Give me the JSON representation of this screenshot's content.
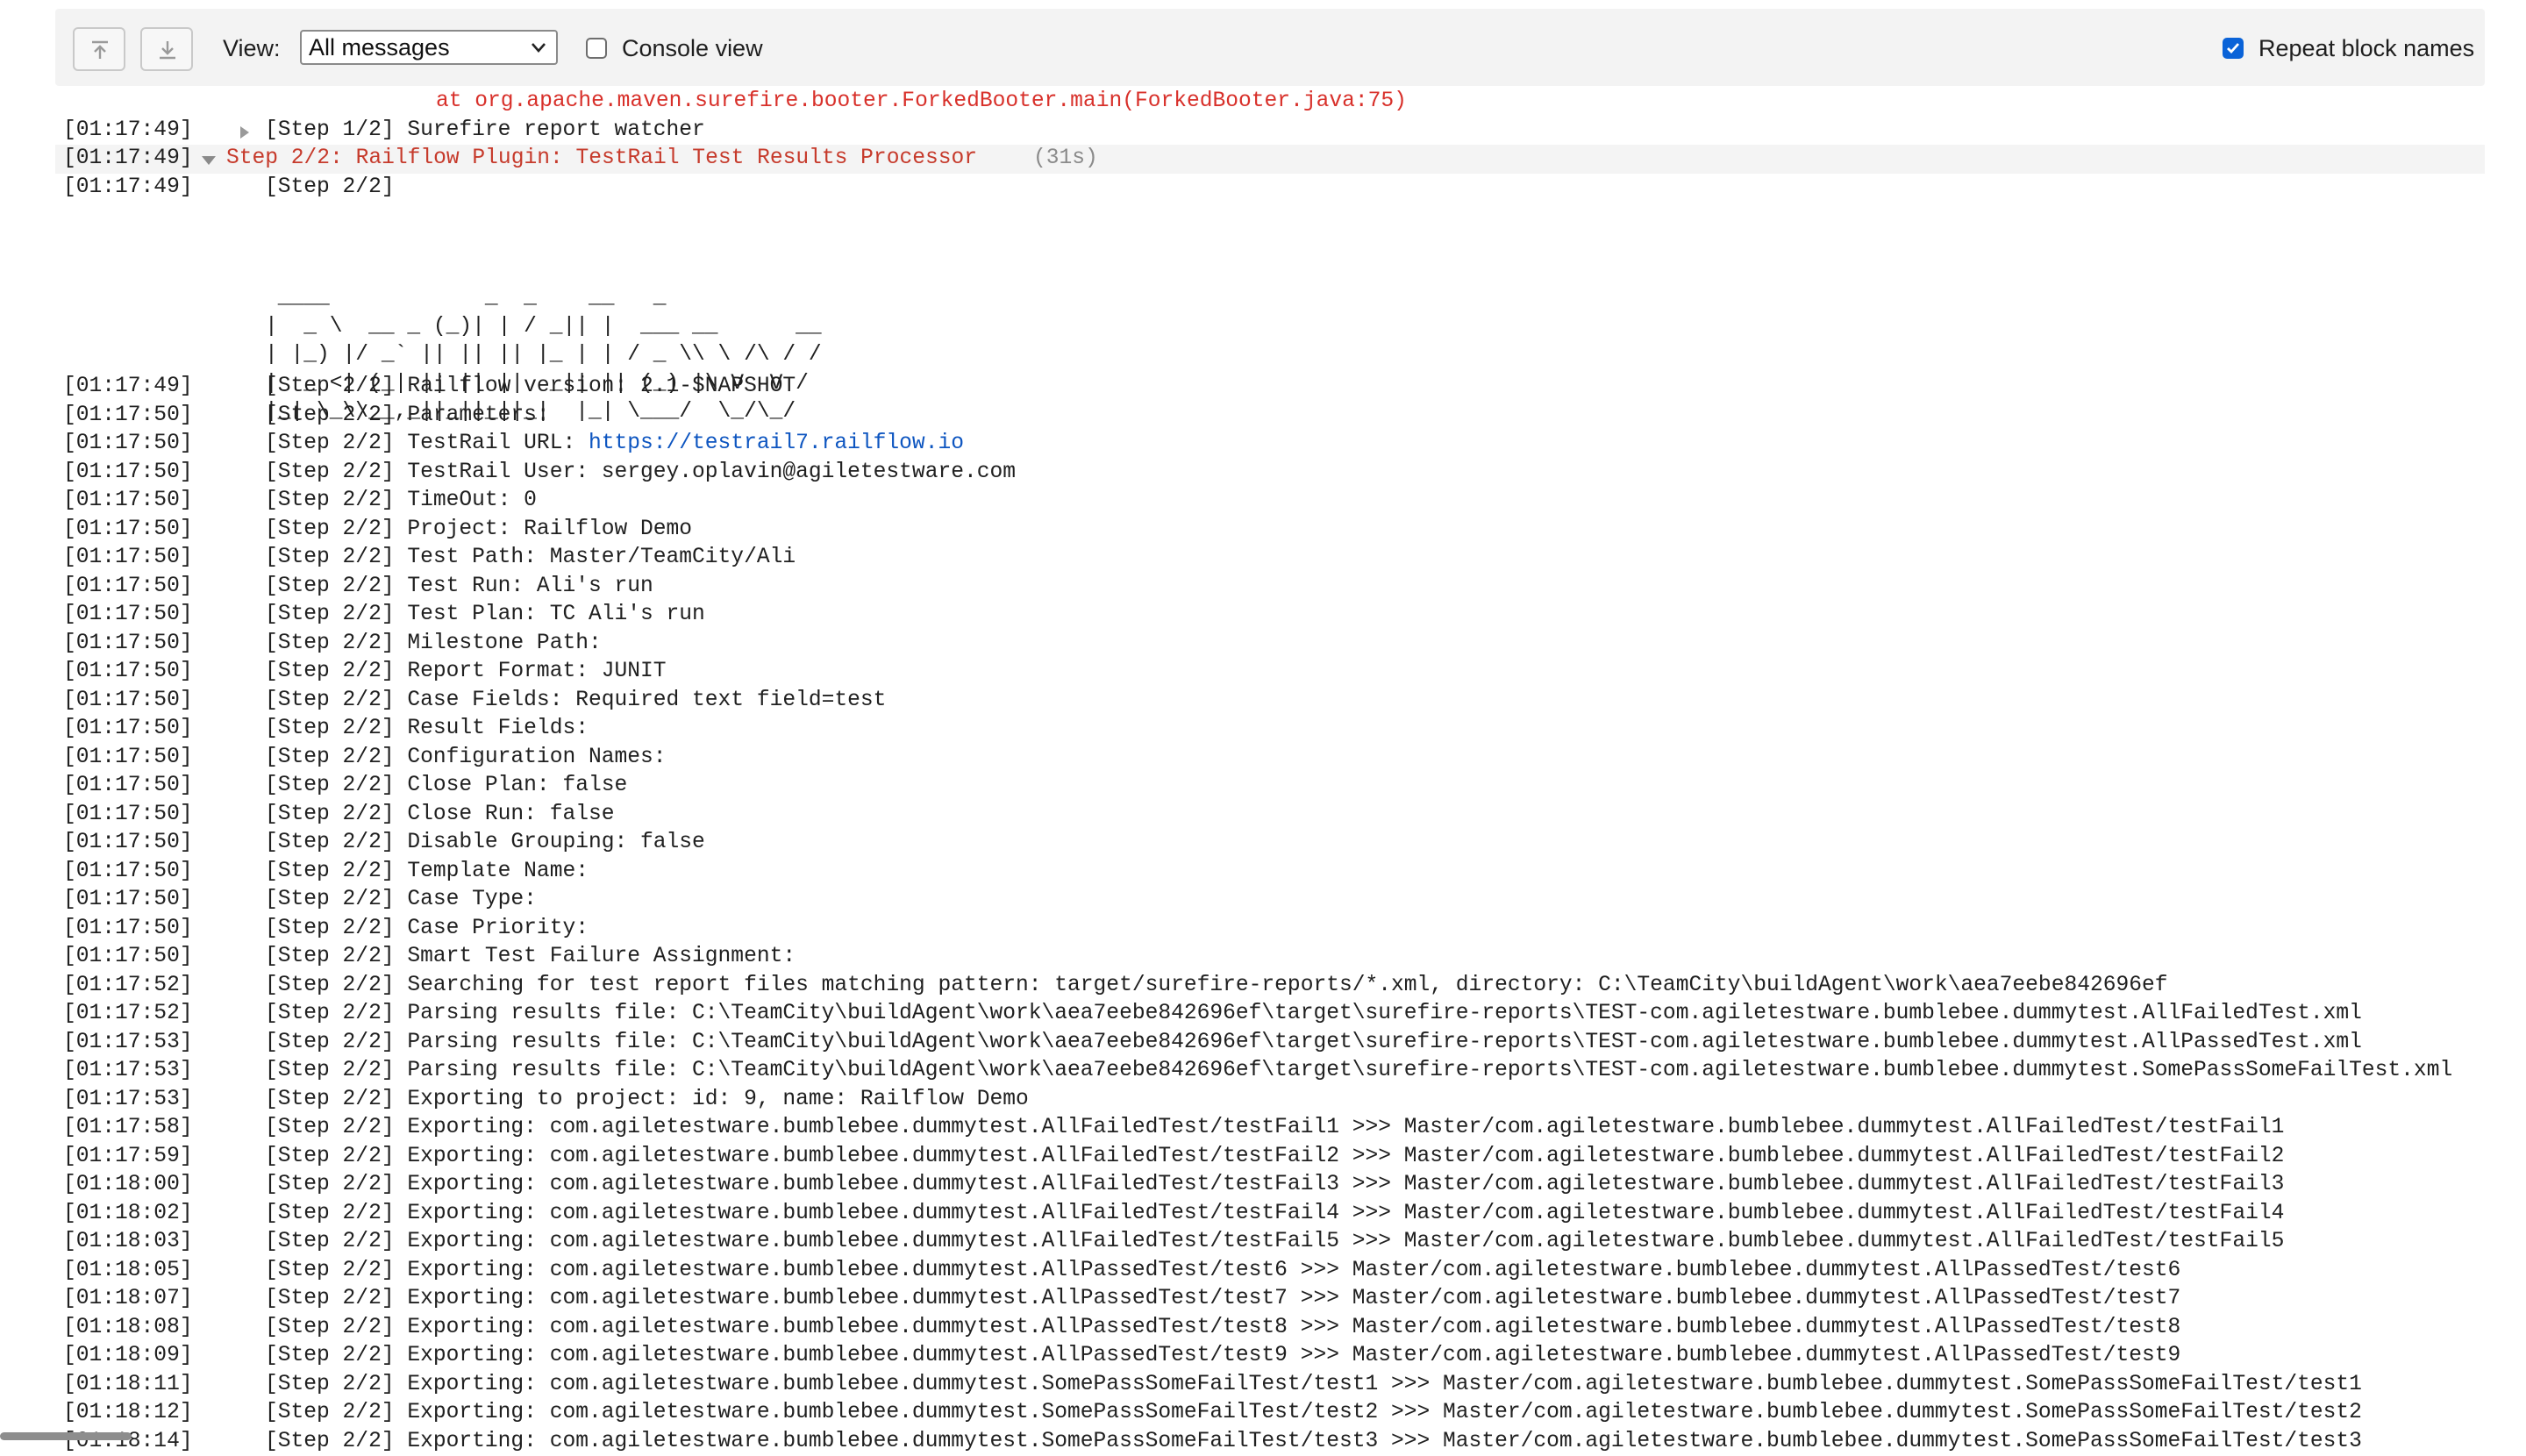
{
  "toolbar": {
    "view_label": "View:",
    "view_select_value": "All messages",
    "console_view_label": "Console view",
    "console_view_checked": false,
    "repeat_block_names_label": "Repeat block names",
    "repeat_block_names_checked": true,
    "icons": [
      "scroll-to-top-icon",
      "scroll-to-bottom-icon",
      "chevron-down-icon",
      "checkmark-icon"
    ],
    "accent_color": "#0a63d8"
  },
  "log": {
    "error_line": "at org.apache.maven.surefire.booter.ForkedBooter.main(ForkedBooter.java:75)",
    "step1": {
      "time": "[01:17:49]",
      "text": "[Step 1/2] Surefire report watcher"
    },
    "step2": {
      "time": "[01:17:49]",
      "title": "Step 2/2: Railflow Plugin: TestRail Test Results Processor",
      "duration": "(31s)"
    },
    "step2_header": {
      "time": "[01:17:49]",
      "text": "[Step 2/2]"
    },
    "ascii_art": " ____            _  _    __   _\n|  _ \\  __ _ (_)| | / _|| |  ___ __      __\n| |_) |/ _` || || || |_ | | / _ \\\\ \\ /\\ / /\n|  _ <| (_| || || ||  _|| || (_) |\\ V  V /\n|_| \\_\\\\__,_||_||_||_|  |_| \\___/  \\_/\\_/",
    "url_line": {
      "time": "[01:17:50]",
      "prefix": "[Step 2/2] TestRail URL: ",
      "link": "https://testrail7.railflow.io"
    },
    "lines_a": [
      {
        "time": "[01:17:49]",
        "text": "[Step 2/2] Railflow version: 2.1-SNAPSHOT"
      },
      {
        "time": "[01:17:50]",
        "text": "[Step 2/2] Parameters:"
      }
    ],
    "lines_b": [
      {
        "time": "[01:17:50]",
        "text": "[Step 2/2] TestRail User: sergey.oplavin@agiletestware.com"
      },
      {
        "time": "[01:17:50]",
        "text": "[Step 2/2] TimeOut: 0"
      },
      {
        "time": "[01:17:50]",
        "text": "[Step 2/2] Project: Railflow Demo"
      },
      {
        "time": "[01:17:50]",
        "text": "[Step 2/2] Test Path: Master/TeamCity/Ali"
      },
      {
        "time": "[01:17:50]",
        "text": "[Step 2/2] Test Run: Ali's run"
      },
      {
        "time": "[01:17:50]",
        "text": "[Step 2/2] Test Plan: TC Ali's run"
      },
      {
        "time": "[01:17:50]",
        "text": "[Step 2/2] Milestone Path:"
      },
      {
        "time": "[01:17:50]",
        "text": "[Step 2/2] Report Format: JUNIT"
      },
      {
        "time": "[01:17:50]",
        "text": "[Step 2/2] Case Fields: Required text field=test"
      },
      {
        "time": "[01:17:50]",
        "text": "[Step 2/2] Result Fields:"
      },
      {
        "time": "[01:17:50]",
        "text": "[Step 2/2] Configuration Names:"
      },
      {
        "time": "[01:17:50]",
        "text": "[Step 2/2] Close Plan: false"
      },
      {
        "time": "[01:17:50]",
        "text": "[Step 2/2] Close Run: false"
      },
      {
        "time": "[01:17:50]",
        "text": "[Step 2/2] Disable Grouping: false"
      },
      {
        "time": "[01:17:50]",
        "text": "[Step 2/2] Template Name:"
      },
      {
        "time": "[01:17:50]",
        "text": "[Step 2/2] Case Type:"
      },
      {
        "time": "[01:17:50]",
        "text": "[Step 2/2] Case Priority:"
      },
      {
        "time": "[01:17:50]",
        "text": "[Step 2/2] Smart Test Failure Assignment:"
      },
      {
        "time": "[01:17:52]",
        "text": "[Step 2/2] Searching for test report files matching pattern: target/surefire-reports/*.xml, directory: C:\\TeamCity\\buildAgent\\work\\aea7eebe842696ef"
      },
      {
        "time": "[01:17:52]",
        "text": "[Step 2/2] Parsing results file: C:\\TeamCity\\buildAgent\\work\\aea7eebe842696ef\\target\\surefire-reports\\TEST-com.agiletestware.bumblebee.dummytest.AllFailedTest.xml"
      },
      {
        "time": "[01:17:53]",
        "text": "[Step 2/2] Parsing results file: C:\\TeamCity\\buildAgent\\work\\aea7eebe842696ef\\target\\surefire-reports\\TEST-com.agiletestware.bumblebee.dummytest.AllPassedTest.xml"
      },
      {
        "time": "[01:17:53]",
        "text": "[Step 2/2] Parsing results file: C:\\TeamCity\\buildAgent\\work\\aea7eebe842696ef\\target\\surefire-reports\\TEST-com.agiletestware.bumblebee.dummytest.SomePassSomeFailTest.xml"
      },
      {
        "time": "[01:17:53]",
        "text": "[Step 2/2] Exporting to project: id: 9, name: Railflow Demo"
      },
      {
        "time": "[01:17:58]",
        "text": "[Step 2/2] Exporting: com.agiletestware.bumblebee.dummytest.AllFailedTest/testFail1 >>> Master/com.agiletestware.bumblebee.dummytest.AllFailedTest/testFail1"
      },
      {
        "time": "[01:17:59]",
        "text": "[Step 2/2] Exporting: com.agiletestware.bumblebee.dummytest.AllFailedTest/testFail2 >>> Master/com.agiletestware.bumblebee.dummytest.AllFailedTest/testFail2"
      },
      {
        "time": "[01:18:00]",
        "text": "[Step 2/2] Exporting: com.agiletestware.bumblebee.dummytest.AllFailedTest/testFail3 >>> Master/com.agiletestware.bumblebee.dummytest.AllFailedTest/testFail3"
      },
      {
        "time": "[01:18:02]",
        "text": "[Step 2/2] Exporting: com.agiletestware.bumblebee.dummytest.AllFailedTest/testFail4 >>> Master/com.agiletestware.bumblebee.dummytest.AllFailedTest/testFail4"
      },
      {
        "time": "[01:18:03]",
        "text": "[Step 2/2] Exporting: com.agiletestware.bumblebee.dummytest.AllFailedTest/testFail5 >>> Master/com.agiletestware.bumblebee.dummytest.AllFailedTest/testFail5"
      },
      {
        "time": "[01:18:05]",
        "text": "[Step 2/2] Exporting: com.agiletestware.bumblebee.dummytest.AllPassedTest/test6 >>> Master/com.agiletestware.bumblebee.dummytest.AllPassedTest/test6"
      },
      {
        "time": "[01:18:07]",
        "text": "[Step 2/2] Exporting: com.agiletestware.bumblebee.dummytest.AllPassedTest/test7 >>> Master/com.agiletestware.bumblebee.dummytest.AllPassedTest/test7"
      },
      {
        "time": "[01:18:08]",
        "text": "[Step 2/2] Exporting: com.agiletestware.bumblebee.dummytest.AllPassedTest/test8 >>> Master/com.agiletestware.bumblebee.dummytest.AllPassedTest/test8"
      },
      {
        "time": "[01:18:09]",
        "text": "[Step 2/2] Exporting: com.agiletestware.bumblebee.dummytest.AllPassedTest/test9 >>> Master/com.agiletestware.bumblebee.dummytest.AllPassedTest/test9"
      },
      {
        "time": "[01:18:11]",
        "text": "[Step 2/2] Exporting: com.agiletestware.bumblebee.dummytest.SomePassSomeFailTest/test1 >>> Master/com.agiletestware.bumblebee.dummytest.SomePassSomeFailTest/test1"
      },
      {
        "time": "[01:18:12]",
        "text": "[Step 2/2] Exporting: com.agiletestware.bumblebee.dummytest.SomePassSomeFailTest/test2 >>> Master/com.agiletestware.bumblebee.dummytest.SomePassSomeFailTest/test2"
      },
      {
        "time": "[01:18:14]",
        "text": "[Step 2/2] Exporting: com.agiletestware.bumblebee.dummytest.SomePassSomeFailTest/test3 >>> Master/com.agiletestware.bumblebee.dummytest.SomePassSomeFailTest/test3"
      }
    ]
  }
}
